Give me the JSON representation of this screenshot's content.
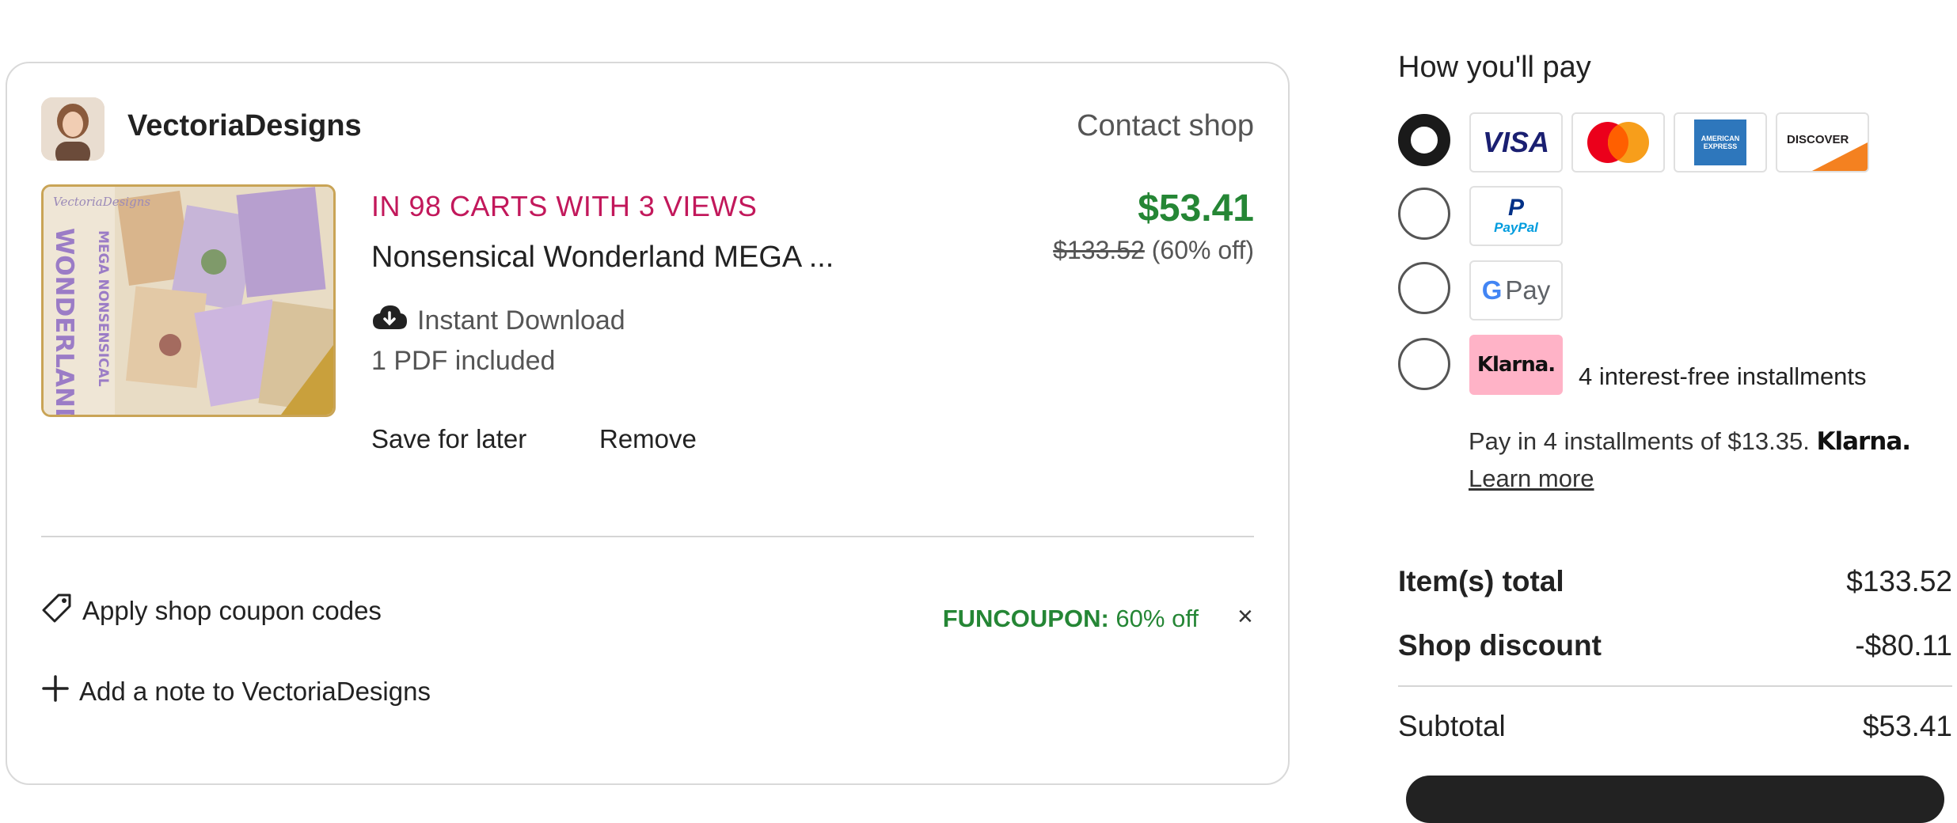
{
  "shop": {
    "name": "VectoriaDesigns",
    "contact_label": "Contact shop"
  },
  "item": {
    "carts_note": "IN 98 CARTS WITH 3 VIEWS",
    "title": "Nonsensical Wonderland MEGA ...",
    "price": "$53.41",
    "original_price": "$133.52",
    "discount_note": "(60% off)",
    "download_label": "Instant Download",
    "files_note": "1 PDF included",
    "thumbnail_text": [
      "VectoriaDesigns",
      "MEGA NONSENSICAL",
      "WONDERLAND"
    ],
    "save_for_later": "Save for later",
    "remove": "Remove"
  },
  "coupon": {
    "apply_label": "Apply shop coupon codes",
    "code": "FUNCOUPON:",
    "code_discount": "60% off",
    "clear": "×"
  },
  "note": {
    "add_label": "Add a note to VectoriaDesigns"
  },
  "payment": {
    "title": "How you'll pay",
    "methods": [
      {
        "name": "Card",
        "selected": true,
        "logos": [
          "VISA",
          "Mastercard",
          "AMERICAN EXPRESS",
          "DISCOVER"
        ]
      },
      {
        "name": "PayPal",
        "selected": false,
        "logos": [
          "PayPal"
        ]
      },
      {
        "name": "Google Pay",
        "selected": false,
        "logos": [
          "G Pay"
        ]
      },
      {
        "name": "Klarna",
        "selected": false,
        "logos": [
          "Klarna."
        ]
      }
    ],
    "logo_text": {
      "visa": "VISA",
      "amex": "AMERICAN EXPRESS",
      "discover": "DISCOVER",
      "paypal": "PayPal",
      "gpay": "Pay",
      "klarna": "Klarna."
    },
    "klarna_note": "4 interest-free installments",
    "installments_text": "Pay in 4 installments of $13.35.",
    "installments_brand": "Klarna.",
    "learn_more": "Learn more"
  },
  "summary": {
    "items_total_label": "Item(s) total",
    "items_total_value": "$133.52",
    "shop_discount_label": "Shop discount",
    "shop_discount_value": "-$80.11",
    "subtotal_label": "Subtotal",
    "subtotal_value": "$53.41"
  },
  "colors": {
    "price_green": "#258635",
    "carts_red": "#c2185b",
    "klarna_pink": "#ffb3c7"
  }
}
